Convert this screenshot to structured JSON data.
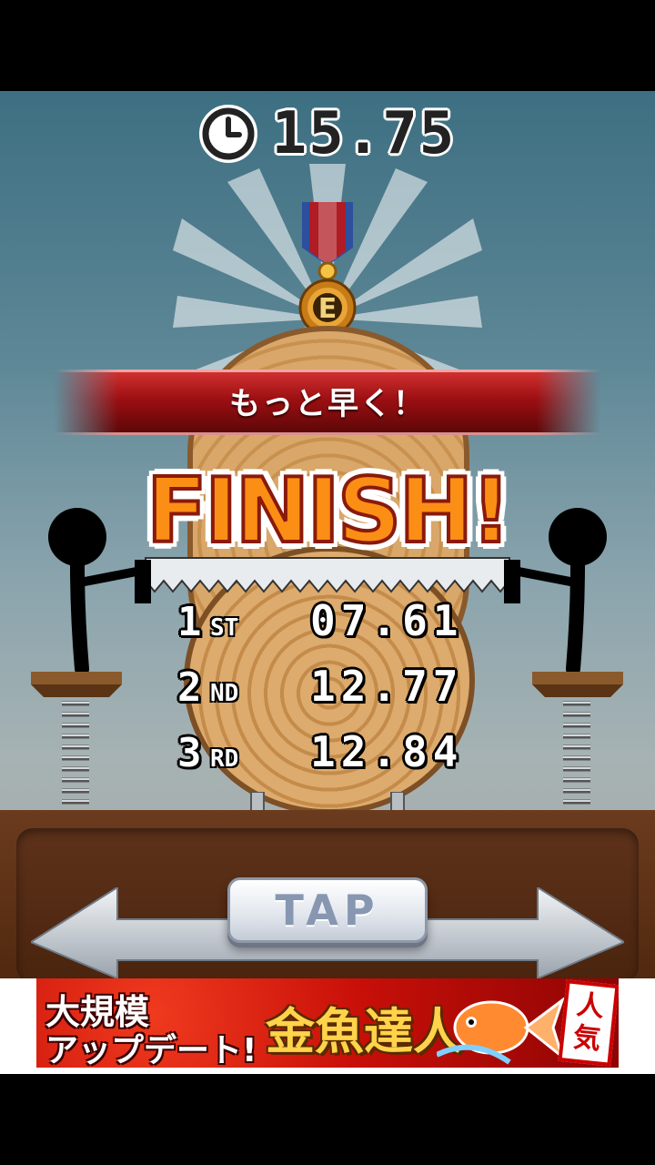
{
  "timer": {
    "value": "15.75",
    "icon": "clock-icon"
  },
  "medal": {
    "grade": "E"
  },
  "banner": {
    "message": "もっと早く！"
  },
  "finish": {
    "text": "FINISH!"
  },
  "ranking": [
    {
      "place": "1",
      "suffix": "ST",
      "time": "07.61"
    },
    {
      "place": "2",
      "suffix": "ND",
      "time": "12.77"
    },
    {
      "place": "3",
      "suffix": "RD",
      "time": "12.84"
    }
  ],
  "controls": {
    "tap_label": "TAP"
  },
  "ad": {
    "line1": "大規模",
    "line2": "アップデート!",
    "title": "金魚達人",
    "badge_top": "人",
    "badge_bottom": "気"
  },
  "colors": {
    "finish": "#fb8e14",
    "banner": "#9c0f12",
    "floor": "#5e321a"
  }
}
